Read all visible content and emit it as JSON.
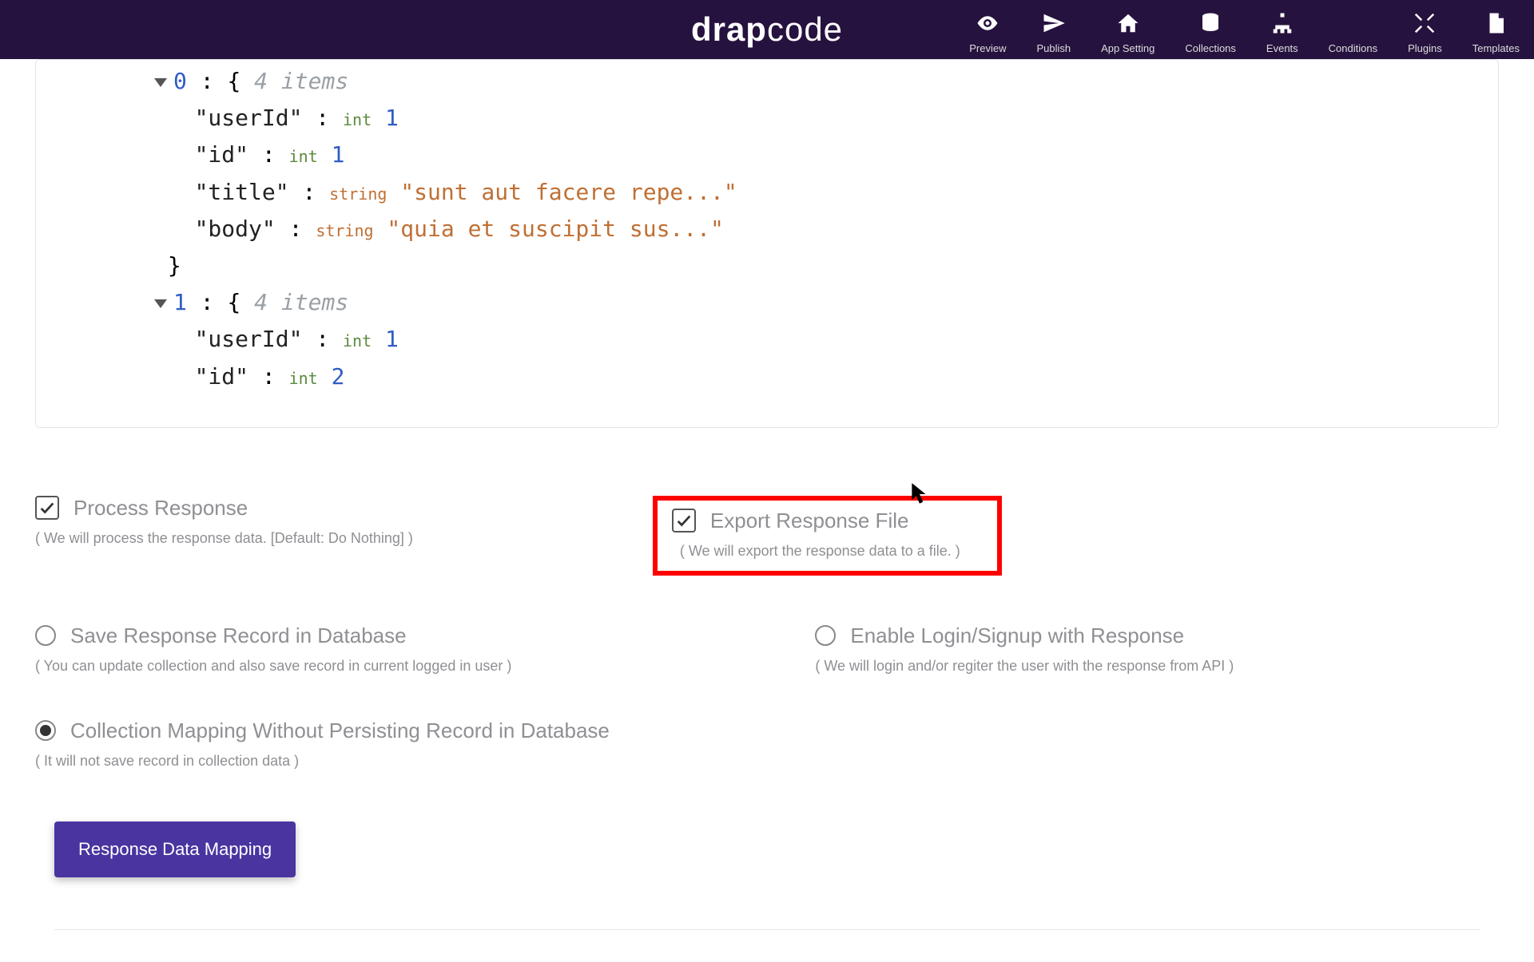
{
  "brand": {
    "name_prefix": "drap",
    "name_suffix": "code"
  },
  "toolbar": {
    "preview": "Preview",
    "publish": "Publish",
    "appsetting": "App Setting",
    "collections": "Collections",
    "events": "Events",
    "conditions": "Conditions",
    "plugins": "Plugins",
    "templates": "Templates"
  },
  "json_view": {
    "obj0": {
      "index": "0",
      "brace_open": "{",
      "meta": "4 items",
      "userId_key": "\"userId\"",
      "userId_type": "int",
      "userId_val": "1",
      "id_key": "\"id\"",
      "id_type": "int",
      "id_val": "1",
      "title_key": "\"title\"",
      "title_type": "string",
      "title_val": "\"sunt aut facere repe...\"",
      "body_key": "\"body\"",
      "body_type": "string",
      "body_val": "\"quia et suscipit sus...\"",
      "brace_close": "}"
    },
    "obj1": {
      "index": "1",
      "brace_open": "{",
      "meta": "4 items",
      "userId_key": "\"userId\"",
      "userId_type": "int",
      "userId_val": "1",
      "id_key": "\"id\"",
      "id_type": "int",
      "id_val": "2"
    }
  },
  "options": {
    "process": {
      "label": "Process Response",
      "help": "( We will process the response data. [Default: Do Nothing] )"
    },
    "export": {
      "label": "Export Response File",
      "help": "( We will export the response data to a file. )"
    },
    "save_db": {
      "label": "Save Response Record in Database",
      "help": "( You can update collection and also save record in current logged in user )"
    },
    "login": {
      "label": "Enable Login/Signup with Response",
      "help": "( We will login and/or regiter the user with the response from API )"
    },
    "map_only": {
      "label": "Collection Mapping Without Persisting Record in Database",
      "help": "( It will not save record in collection data )"
    }
  },
  "tabs": {
    "response_mapping": "Response Data Mapping"
  }
}
